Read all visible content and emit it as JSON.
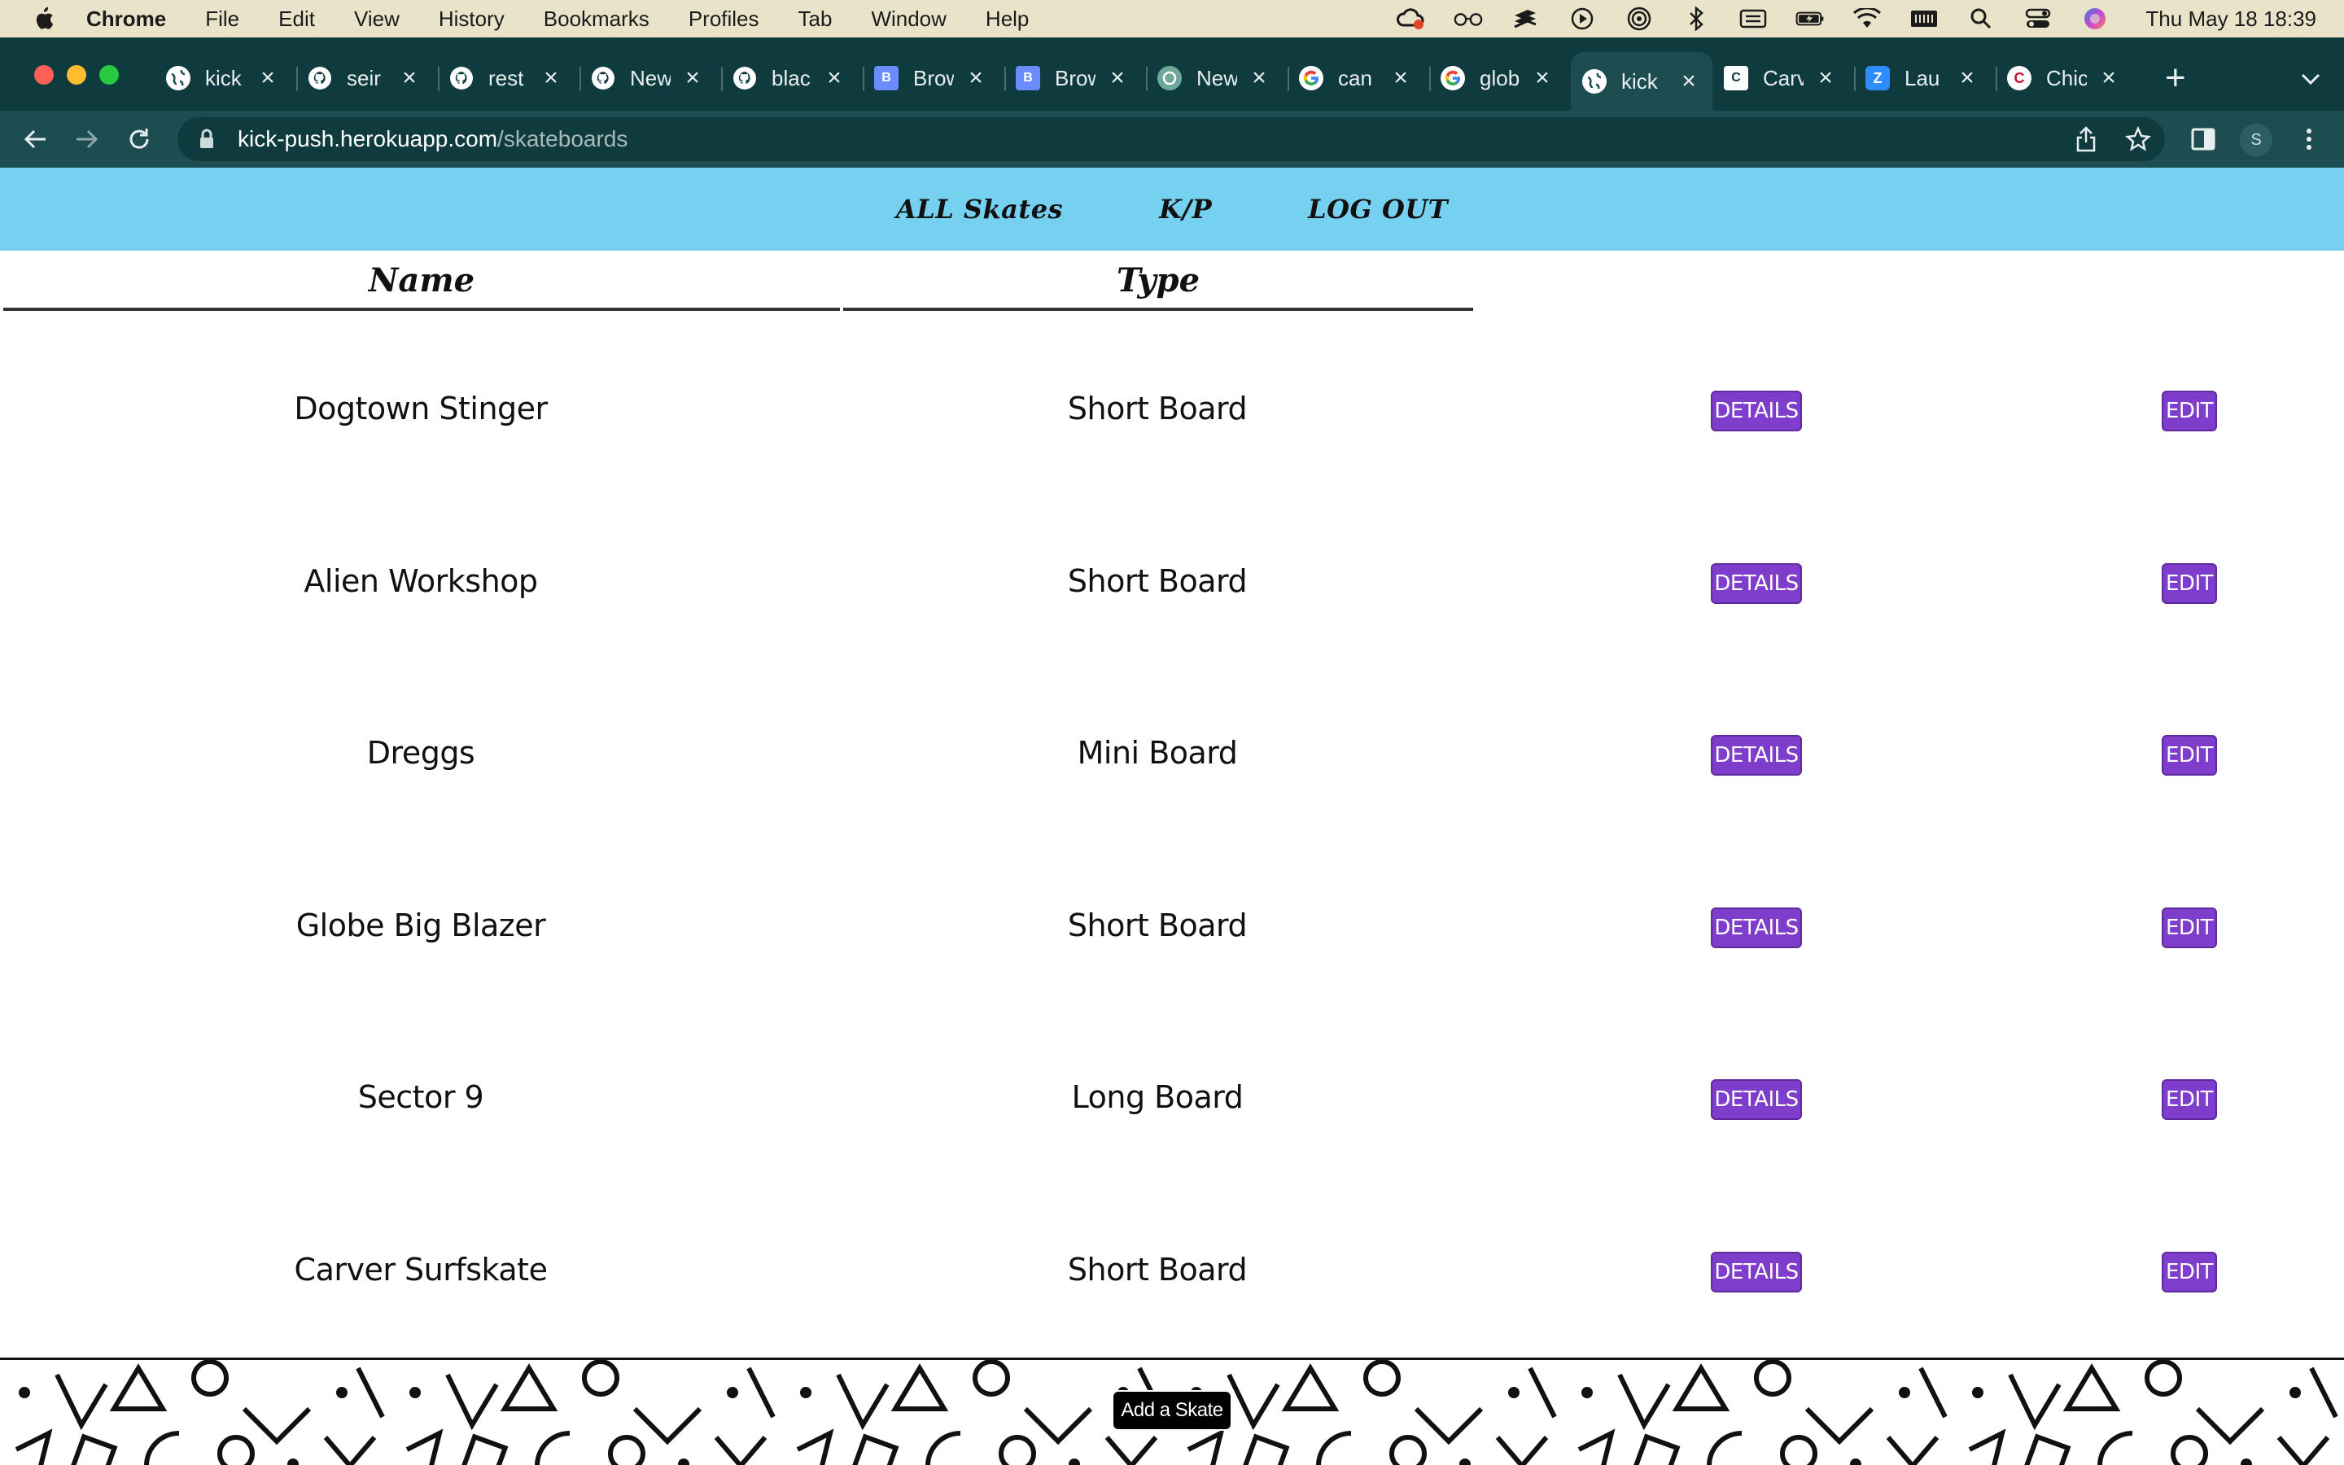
{
  "menubar": {
    "app": "Chrome",
    "items": [
      "File",
      "Edit",
      "View",
      "History",
      "Bookmarks",
      "Profiles",
      "Tab",
      "Window",
      "Help"
    ],
    "clock": "Thu May 18  18:39",
    "status_icons": [
      "creative-cloud-icon",
      "glasses-icon",
      "stack-icon",
      "play-icon",
      "airdrop-icon",
      "bluetooth-icon",
      "keyboard-icon",
      "battery-icon",
      "wifi-icon",
      "memory-icon",
      "search-icon",
      "control-center-icon",
      "siri-icon"
    ]
  },
  "tabs": [
    {
      "title": "kick",
      "favicon": "globe-icon",
      "active": false
    },
    {
      "title": "seir",
      "favicon": "github-icon",
      "active": false
    },
    {
      "title": "rest",
      "favicon": "github-icon",
      "active": false
    },
    {
      "title": "New",
      "favicon": "github-icon",
      "active": false
    },
    {
      "title": "blac",
      "favicon": "github-icon",
      "active": false
    },
    {
      "title": "Brow",
      "favicon": "brand-icon",
      "active": false
    },
    {
      "title": "Brow",
      "favicon": "brand-icon",
      "active": false
    },
    {
      "title": "New",
      "favicon": "openai-icon",
      "active": false
    },
    {
      "title": "can",
      "favicon": "google-icon",
      "active": false
    },
    {
      "title": "glob",
      "favicon": "google-icon",
      "active": false
    },
    {
      "title": "kick",
      "favicon": "globe-icon",
      "active": true
    },
    {
      "title": "Carv",
      "favicon": "carver-icon",
      "active": false
    },
    {
      "title": "Lau",
      "favicon": "zoom-icon",
      "active": false
    },
    {
      "title": "Chic",
      "favicon": "chicago-icon",
      "active": false
    }
  ],
  "toolbar": {
    "url_host": "kick-push.herokuapp.com",
    "url_path": "/skateboards",
    "avatar_initial": "S"
  },
  "nav": {
    "all_skates": "ALL Skates",
    "kp": "K/P",
    "logout": "LOG OUT"
  },
  "table": {
    "headers": [
      "Name",
      "Type"
    ],
    "rows": [
      {
        "name": "Dogtown Stinger",
        "type": "Short Board",
        "details": "DETAILS",
        "edit": "EDIT"
      },
      {
        "name": "Alien Workshop",
        "type": "Short Board",
        "details": "DETAILS",
        "edit": "EDIT"
      },
      {
        "name": "Dreggs",
        "type": "Mini Board",
        "details": "DETAILS",
        "edit": "EDIT"
      },
      {
        "name": "Globe Big Blazer",
        "type": "Short Board",
        "details": "DETAILS",
        "edit": "EDIT"
      },
      {
        "name": "Sector 9",
        "type": "Long Board",
        "details": "DETAILS",
        "edit": "EDIT"
      },
      {
        "name": "Carver Surfskate",
        "type": "Short Board",
        "details": "DETAILS",
        "edit": "EDIT"
      }
    ]
  },
  "footer": {
    "add_label": "Add a Skate"
  },
  "colors": {
    "nav_bg": "#75d1ef",
    "button_bg": "#7f3dcc",
    "tabstrip_bg": "#0f3b3f",
    "toolbar_bg": "#1d4d51",
    "menubar_bg": "#e9e4c9"
  }
}
